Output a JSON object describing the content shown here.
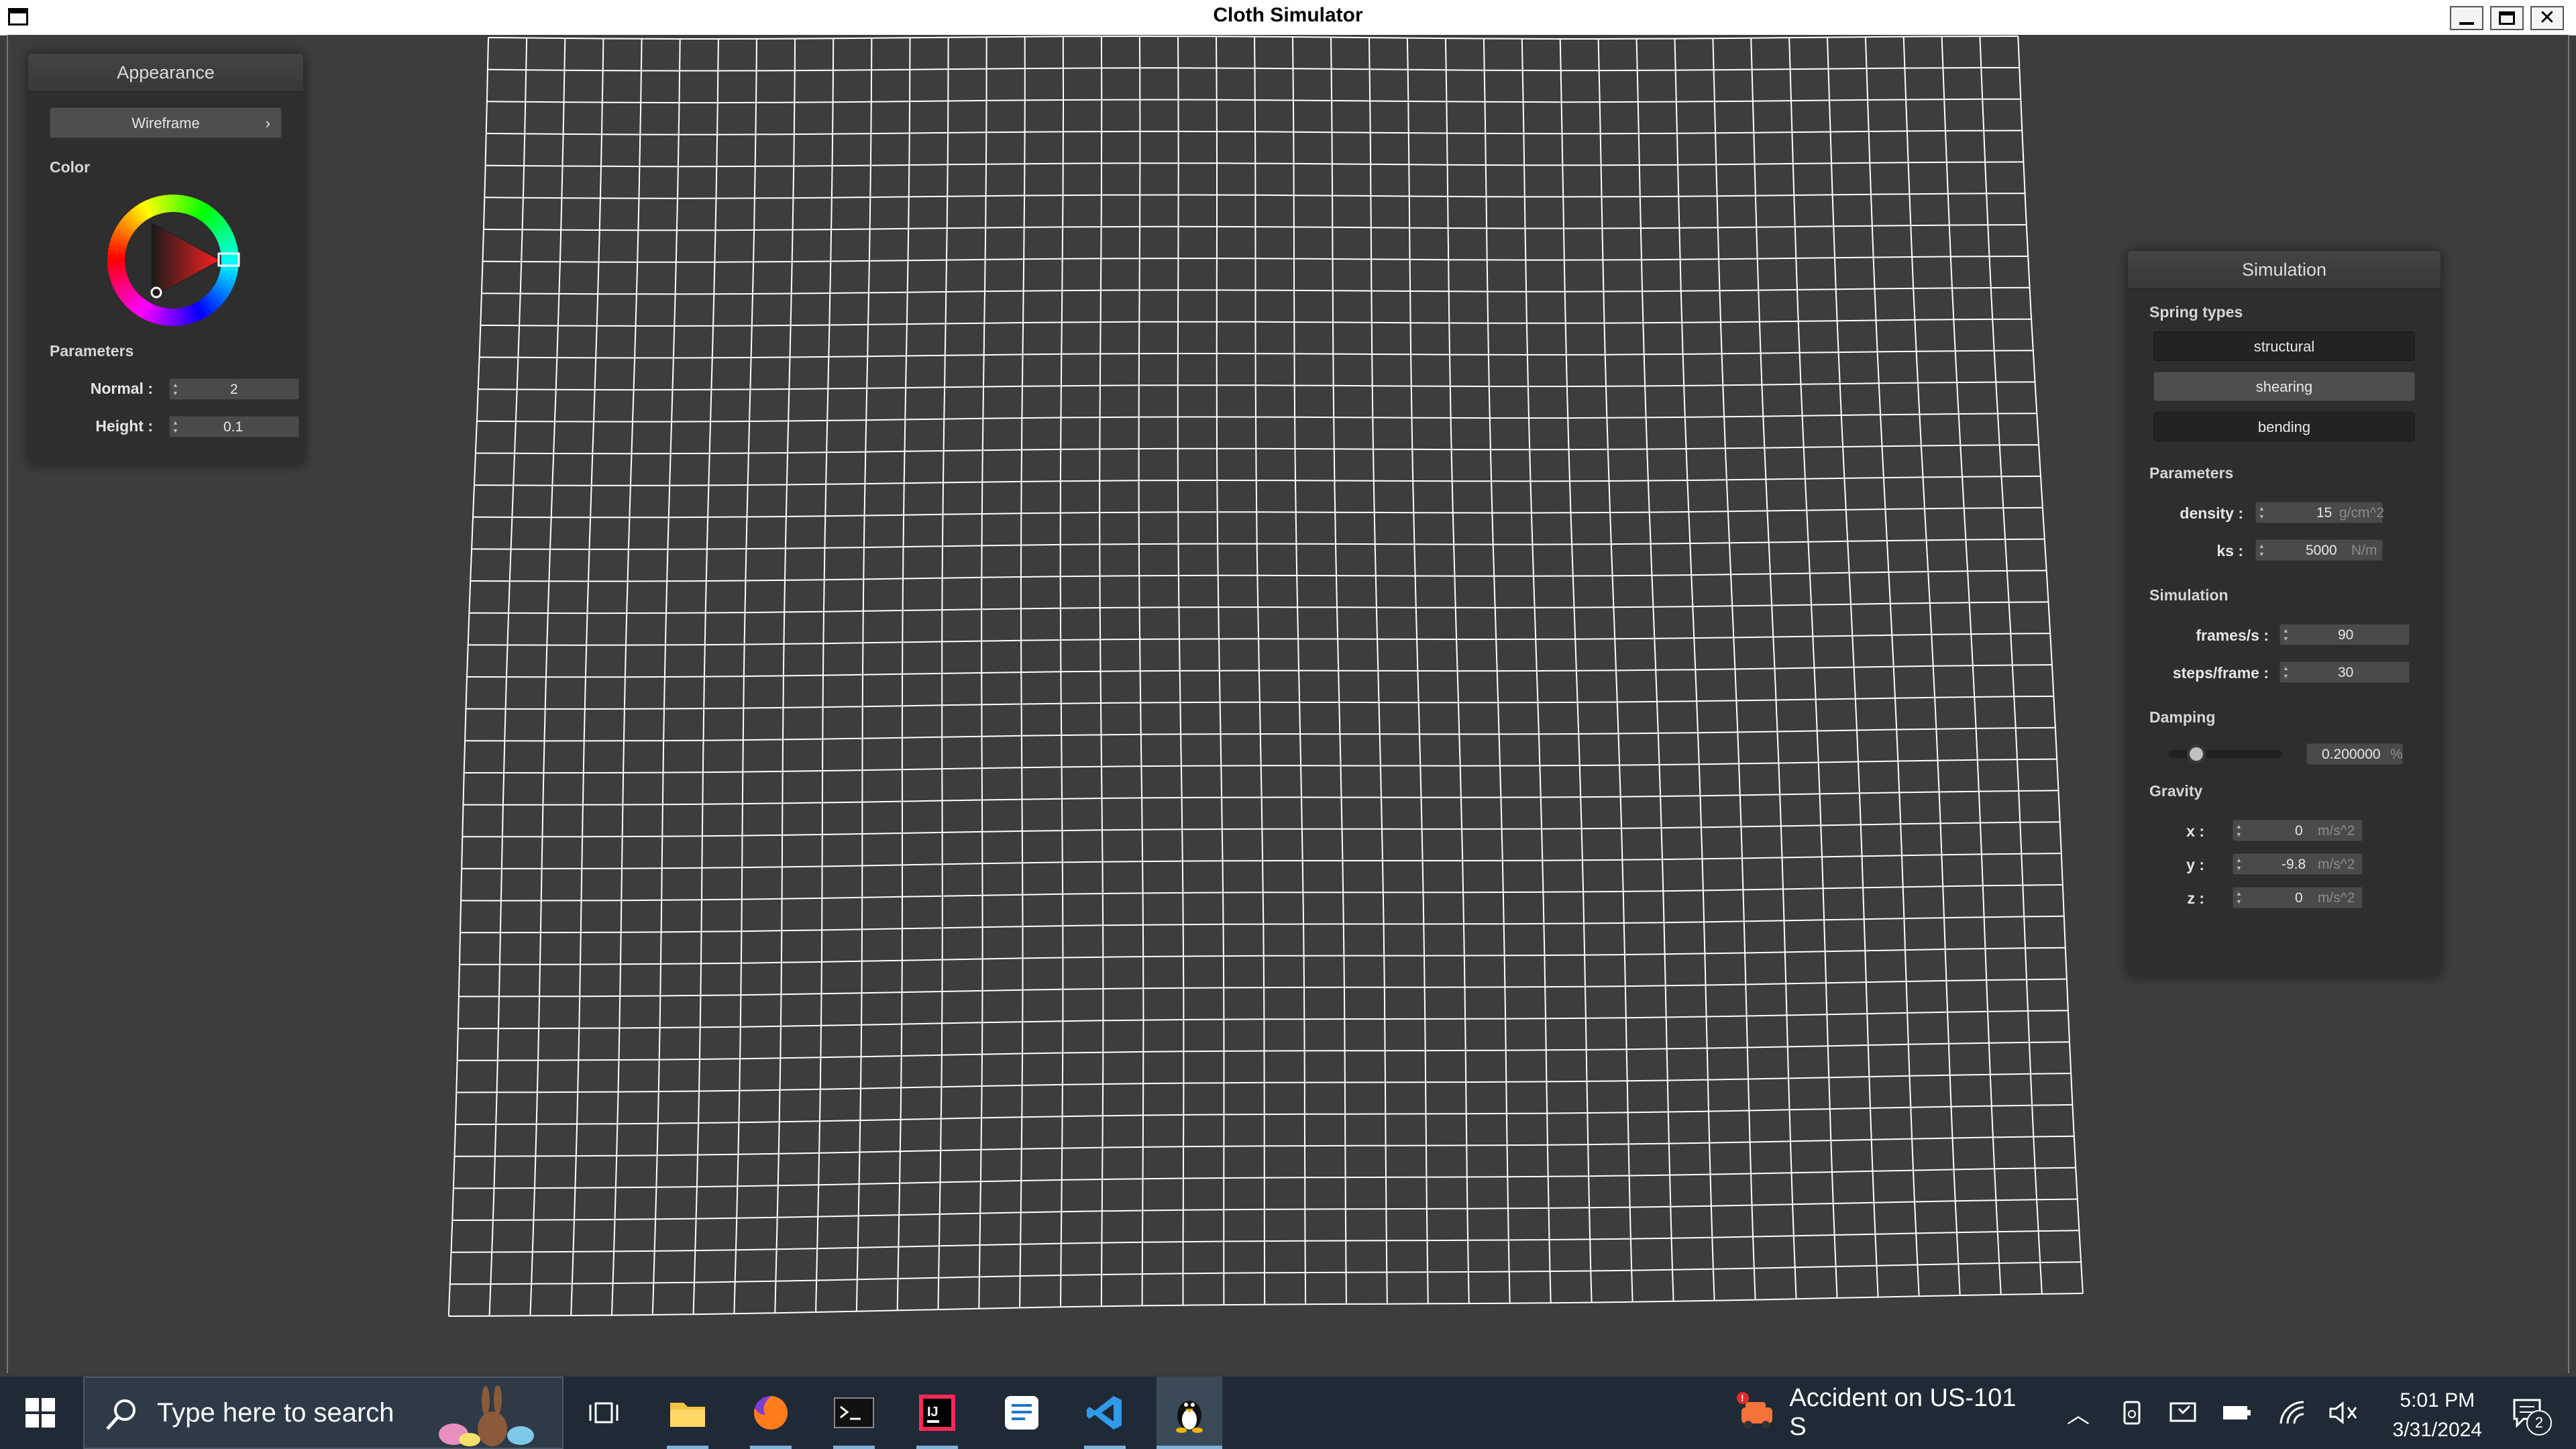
{
  "window": {
    "title": "Cloth Simulator"
  },
  "appearance": {
    "title": "Appearance",
    "mode": "Wireframe",
    "color_label": "Color",
    "params_label": "Parameters",
    "normal_label": "Normal :",
    "normal_value": "2",
    "height_label": "Height :",
    "height_value": "0.1"
  },
  "simulation": {
    "title": "Simulation",
    "spring_types_label": "Spring types",
    "springs": [
      "structural",
      "shearing",
      "bending"
    ],
    "params_label": "Parameters",
    "density_label": "density :",
    "density_value": "15",
    "density_unit": "g/cm^2",
    "ks_label": "ks :",
    "ks_value": "5000",
    "ks_unit": "N/m",
    "sim_label": "Simulation",
    "fps_label": "frames/s :",
    "fps_value": "90",
    "steps_label": "steps/frame :",
    "steps_value": "30",
    "damping_label": "Damping",
    "damping_value": "0.200000",
    "damping_unit": "%",
    "gravity_label": "Gravity",
    "gx_label": "x :",
    "gx_value": "0",
    "gy_label": "y :",
    "gy_value": "-9.8",
    "gz_label": "z :",
    "gz_value": "0",
    "g_unit": "m/s^2"
  },
  "taskbar": {
    "search_placeholder": "Type here to search",
    "news": "Accident on US-101 S",
    "time": "5:01 PM",
    "date": "3/31/2024",
    "notifications": "2"
  },
  "colors": {
    "cloth_lines": "#ffffff",
    "background": "#3d3d3d",
    "panel": "#2e2e2e",
    "taskbar": "#1f2a36"
  }
}
